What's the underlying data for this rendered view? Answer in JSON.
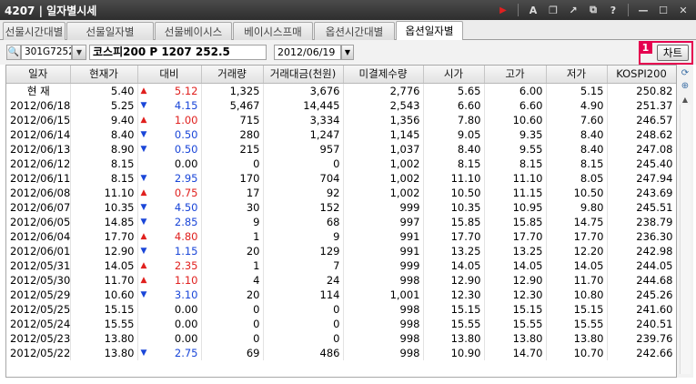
{
  "window": {
    "title": "4207 | 일자별시세",
    "buttons": [
      {
        "name": "play-icon",
        "glyph": "▶"
      },
      {
        "name": "font-icon",
        "glyph": "A"
      },
      {
        "name": "window-icon",
        "glyph": "❐"
      },
      {
        "name": "expand-icon",
        "glyph": "↗"
      },
      {
        "name": "copy-icon",
        "glyph": "⧉"
      },
      {
        "name": "help-icon",
        "glyph": "?"
      },
      {
        "name": "minimize-icon",
        "glyph": "—"
      },
      {
        "name": "maximize-icon",
        "glyph": "☐"
      },
      {
        "name": "close-icon",
        "glyph": "✕"
      }
    ]
  },
  "tabs": [
    {
      "label": "선물시간대별",
      "active": false
    },
    {
      "label": "선물일자별",
      "active": false
    },
    {
      "label": "선물베이시스",
      "active": false
    },
    {
      "label": "베이시스프매",
      "active": false
    },
    {
      "label": "옵션시간대별",
      "active": false
    },
    {
      "label": "옵션일자별",
      "active": true
    }
  ],
  "toolbar": {
    "code": "301G7252",
    "name": "코스피200 P 1207 252.5",
    "date": "2012/06/19",
    "callout_number": "1",
    "chart_button": "차트"
  },
  "table": {
    "columns": [
      "일자",
      "현재가",
      "대비",
      "거래량",
      "거래대금(천원)",
      "미결제수량",
      "시가",
      "고가",
      "저가",
      "KOSPI200"
    ],
    "rows": [
      {
        "date": "현 재",
        "price": "5.40",
        "dir": "up",
        "chg": "5.12",
        "vol": "1,325",
        "amt": "3,676",
        "oi": "2,776",
        "open": "5.65",
        "high": "6.00",
        "low": "5.15",
        "kospi": "250.82"
      },
      {
        "date": "2012/06/18",
        "price": "5.25",
        "dir": "down",
        "chg": "4.15",
        "vol": "5,467",
        "amt": "14,445",
        "oi": "2,543",
        "open": "6.60",
        "high": "6.60",
        "low": "4.90",
        "kospi": "251.37"
      },
      {
        "date": "2012/06/15",
        "price": "9.40",
        "dir": "up",
        "chg": "1.00",
        "vol": "715",
        "amt": "3,334",
        "oi": "1,356",
        "open": "7.80",
        "high": "10.60",
        "low": "7.60",
        "kospi": "246.57"
      },
      {
        "date": "2012/06/14",
        "price": "8.40",
        "dir": "down",
        "chg": "0.50",
        "vol": "280",
        "amt": "1,247",
        "oi": "1,145",
        "open": "9.05",
        "high": "9.35",
        "low": "8.40",
        "kospi": "248.62"
      },
      {
        "date": "2012/06/13",
        "price": "8.90",
        "dir": "down",
        "chg": "0.50",
        "vol": "215",
        "amt": "957",
        "oi": "1,037",
        "open": "8.40",
        "high": "9.55",
        "low": "8.40",
        "kospi": "247.08"
      },
      {
        "date": "2012/06/12",
        "price": "8.15",
        "dir": "flat",
        "chg": "0.00",
        "vol": "0",
        "amt": "0",
        "oi": "1,002",
        "open": "8.15",
        "high": "8.15",
        "low": "8.15",
        "kospi": "245.40"
      },
      {
        "date": "2012/06/11",
        "price": "8.15",
        "dir": "down",
        "chg": "2.95",
        "vol": "170",
        "amt": "704",
        "oi": "1,002",
        "open": "11.10",
        "high": "11.10",
        "low": "8.05",
        "kospi": "247.94"
      },
      {
        "date": "2012/06/08",
        "price": "11.10",
        "dir": "up",
        "chg": "0.75",
        "vol": "17",
        "amt": "92",
        "oi": "1,002",
        "open": "10.50",
        "high": "11.15",
        "low": "10.50",
        "kospi": "243.69"
      },
      {
        "date": "2012/06/07",
        "price": "10.35",
        "dir": "down",
        "chg": "4.50",
        "vol": "30",
        "amt": "152",
        "oi": "999",
        "open": "10.35",
        "high": "10.95",
        "low": "9.80",
        "kospi": "245.51"
      },
      {
        "date": "2012/06/05",
        "price": "14.85",
        "dir": "down",
        "chg": "2.85",
        "vol": "9",
        "amt": "68",
        "oi": "997",
        "open": "15.85",
        "high": "15.85",
        "low": "14.75",
        "kospi": "238.79"
      },
      {
        "date": "2012/06/04",
        "price": "17.70",
        "dir": "up",
        "chg": "4.80",
        "vol": "1",
        "amt": "9",
        "oi": "991",
        "open": "17.70",
        "high": "17.70",
        "low": "17.70",
        "kospi": "236.30"
      },
      {
        "date": "2012/06/01",
        "price": "12.90",
        "dir": "down",
        "chg": "1.15",
        "vol": "20",
        "amt": "129",
        "oi": "991",
        "open": "13.25",
        "high": "13.25",
        "low": "12.20",
        "kospi": "242.98"
      },
      {
        "date": "2012/05/31",
        "price": "14.05",
        "dir": "up",
        "chg": "2.35",
        "vol": "1",
        "amt": "7",
        "oi": "999",
        "open": "14.05",
        "high": "14.05",
        "low": "14.05",
        "kospi": "244.05"
      },
      {
        "date": "2012/05/30",
        "price": "11.70",
        "dir": "up",
        "chg": "1.10",
        "vol": "4",
        "amt": "24",
        "oi": "998",
        "open": "12.90",
        "high": "12.90",
        "low": "11.70",
        "kospi": "244.68"
      },
      {
        "date": "2012/05/29",
        "price": "10.60",
        "dir": "down",
        "chg": "3.10",
        "vol": "20",
        "amt": "114",
        "oi": "1,001",
        "open": "12.30",
        "high": "12.30",
        "low": "10.80",
        "kospi": "245.26"
      },
      {
        "date": "2012/05/25",
        "price": "15.15",
        "dir": "flat",
        "chg": "0.00",
        "vol": "0",
        "amt": "0",
        "oi": "998",
        "open": "15.15",
        "high": "15.15",
        "low": "15.15",
        "kospi": "241.60"
      },
      {
        "date": "2012/05/24",
        "price": "15.55",
        "dir": "flat",
        "chg": "0.00",
        "vol": "0",
        "amt": "0",
        "oi": "998",
        "open": "15.55",
        "high": "15.55",
        "low": "15.55",
        "kospi": "240.51"
      },
      {
        "date": "2012/05/23",
        "price": "13.80",
        "dir": "flat",
        "chg": "0.00",
        "vol": "0",
        "amt": "0",
        "oi": "998",
        "open": "13.80",
        "high": "13.80",
        "low": "13.80",
        "kospi": "239.76"
      },
      {
        "date": "2012/05/22",
        "price": "13.80",
        "dir": "down",
        "chg": "2.75",
        "vol": "69",
        "amt": "486",
        "oi": "998",
        "open": "10.90",
        "high": "14.70",
        "low": "10.70",
        "kospi": "242.66"
      }
    ]
  },
  "colors": {
    "up": "#e0201e",
    "down": "#1a46d8",
    "callout": "#e5004f"
  },
  "side_tools": [
    {
      "name": "refresh-icon",
      "glyph": "⟳"
    },
    {
      "name": "zoom-in-icon",
      "glyph": "⊕"
    }
  ]
}
